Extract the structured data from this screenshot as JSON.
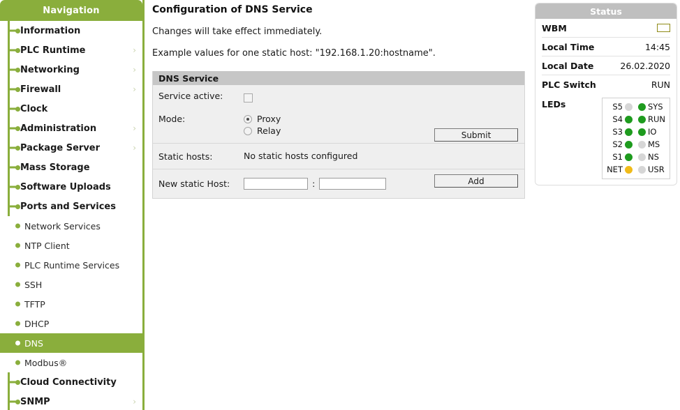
{
  "sidebar": {
    "header": "Navigation",
    "items": [
      {
        "label": "Information",
        "level": "top",
        "chevron": false,
        "active": false
      },
      {
        "label": "PLC Runtime",
        "level": "top",
        "chevron": true,
        "active": false
      },
      {
        "label": "Networking",
        "level": "top",
        "chevron": true,
        "active": false
      },
      {
        "label": "Firewall",
        "level": "top",
        "chevron": true,
        "active": false
      },
      {
        "label": "Clock",
        "level": "top",
        "chevron": false,
        "active": false
      },
      {
        "label": "Administration",
        "level": "top",
        "chevron": true,
        "active": false
      },
      {
        "label": "Package Server",
        "level": "top",
        "chevron": true,
        "active": false
      },
      {
        "label": "Mass Storage",
        "level": "top",
        "chevron": false,
        "active": false
      },
      {
        "label": "Software Uploads",
        "level": "top",
        "chevron": false,
        "active": false
      },
      {
        "label": "Ports and Services",
        "level": "top",
        "chevron": false,
        "active": false
      },
      {
        "label": "Network Services",
        "level": "sub",
        "chevron": false,
        "active": false
      },
      {
        "label": "NTP Client",
        "level": "sub",
        "chevron": false,
        "active": false
      },
      {
        "label": "PLC Runtime Services",
        "level": "sub",
        "chevron": false,
        "active": false
      },
      {
        "label": "SSH",
        "level": "sub",
        "chevron": false,
        "active": false
      },
      {
        "label": "TFTP",
        "level": "sub",
        "chevron": false,
        "active": false
      },
      {
        "label": "DHCP",
        "level": "sub",
        "chevron": false,
        "active": false
      },
      {
        "label": "DNS",
        "level": "sub",
        "chevron": false,
        "active": true
      },
      {
        "label": "Modbus®",
        "level": "sub",
        "chevron": false,
        "active": false
      },
      {
        "label": "Cloud Connectivity",
        "level": "top",
        "chevron": false,
        "active": false
      },
      {
        "label": "SNMP",
        "level": "top",
        "chevron": true,
        "active": false
      }
    ],
    "chevron_glyph": "›",
    "accent_color": "#8aae3c"
  },
  "main": {
    "title": "Configuration of DNS Service",
    "note1": "Changes will take effect immediately.",
    "note2": "Example values for one static host: \"192.168.1.20:hostname\".",
    "panel_title": "DNS Service",
    "rows": {
      "service_active_label": "Service active:",
      "service_active_checked": false,
      "mode_label": "Mode:",
      "mode_options": [
        {
          "label": "Proxy",
          "selected": true
        },
        {
          "label": "Relay",
          "selected": false
        }
      ],
      "submit_label": "Submit",
      "static_hosts_label": "Static hosts:",
      "static_hosts_value": "No static hosts configured",
      "new_host_label": "New static Host:",
      "new_host_ip_value": "",
      "new_host_ip_placeholder": "",
      "new_host_name_value": "",
      "new_host_name_placeholder": "",
      "separator": ":",
      "add_label": "Add"
    }
  },
  "status": {
    "header": "Status",
    "rows": [
      {
        "key": "WBM",
        "value": ""
      },
      {
        "key": "Local Time",
        "value": "14:45"
      },
      {
        "key": "Local Date",
        "value": "26.02.2020"
      },
      {
        "key": "PLC Switch",
        "value": "RUN"
      }
    ],
    "leds_label": "LEDs",
    "leds": [
      {
        "left_label": "S5",
        "left_state": "off",
        "right_state": "green",
        "right_label": "SYS"
      },
      {
        "left_label": "S4",
        "left_state": "green",
        "right_state": "green",
        "right_label": "RUN"
      },
      {
        "left_label": "S3",
        "left_state": "green",
        "right_state": "green",
        "right_label": "IO"
      },
      {
        "left_label": "S2",
        "left_state": "green",
        "right_state": "off",
        "right_label": "MS"
      },
      {
        "left_label": "S1",
        "left_state": "green",
        "right_state": "off",
        "right_label": "NS"
      },
      {
        "left_label": "NET",
        "left_state": "amber",
        "right_state": "off",
        "right_label": "USR"
      }
    ],
    "colors": {
      "green": "#1e9b1e",
      "amber": "#f0bb1a",
      "off": "#d6d6d6",
      "header_bg": "#bfbfbf"
    }
  }
}
